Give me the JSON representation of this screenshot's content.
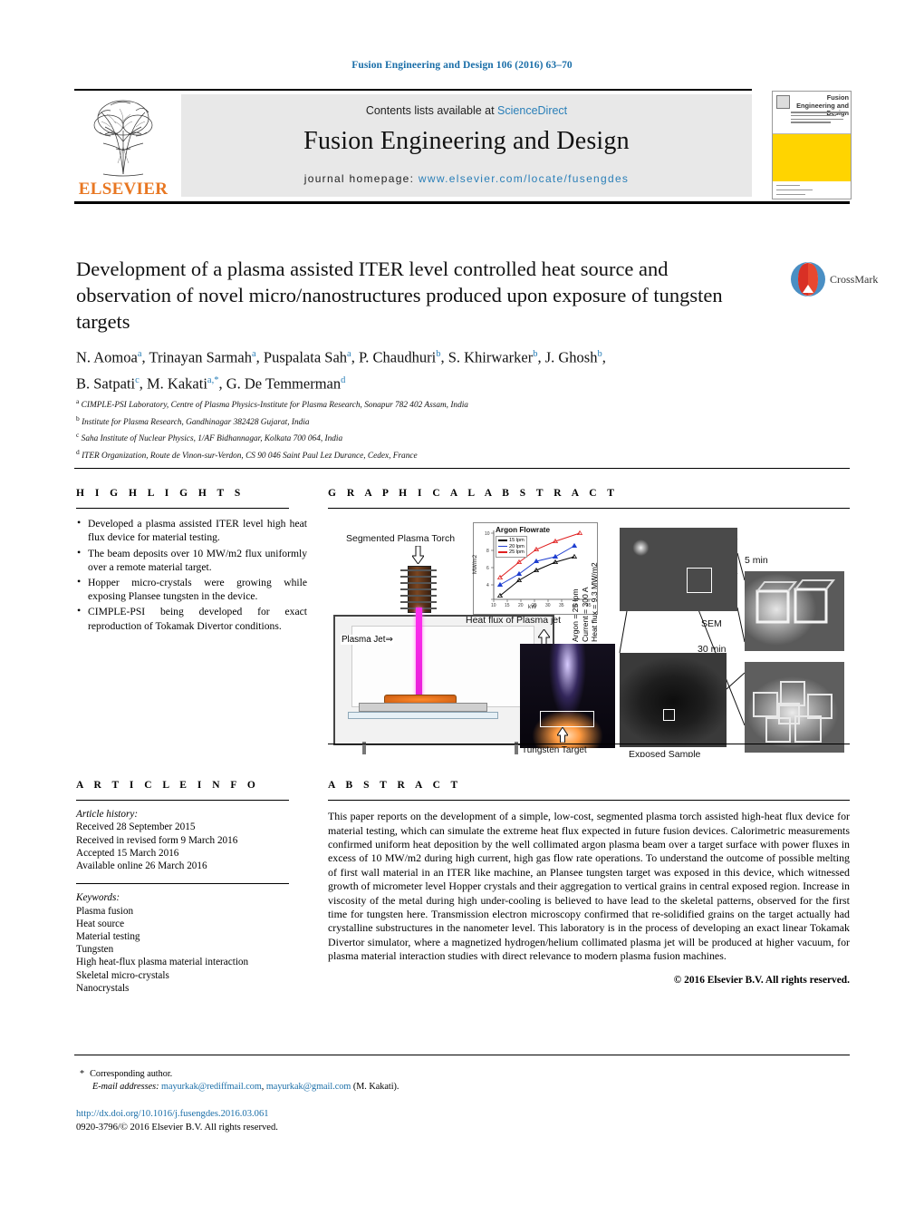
{
  "running_head": "Fusion Engineering and Design 106 (2016) 63–70",
  "masthead": {
    "contents_prefix": "Contents lists available at ",
    "sciencedirect": "ScienceDirect",
    "journal_title": "Fusion Engineering and Design",
    "homepage_prefix": "journal homepage: ",
    "homepage_url": "www.elsevier.com/locate/fusengdes",
    "publisher": "ELSEVIER",
    "cover_journal_title": "Fusion Engineering and Design",
    "cover_accent_color": "#FFD400"
  },
  "article": {
    "title": "Development of a plasma assisted ITER level controlled heat source and observation of novel micro/nanostructures produced upon exposure of tungsten targets",
    "crossmark_label": "CrossMark",
    "authors_line1": "N. Aomoa a, Trinayan Sarmah a, Puspalata Sah a, P. Chaudhuri b, S. Khirwarker b, J. Ghosh b,",
    "authors_line2": "B. Satpati c, M. Kakati a,*, G. De Temmerman d",
    "affiliations": [
      "CIMPLE-PSI Laboratory, Centre of Plasma Physics-Institute for Plasma Research, Sonapur 782 402 Assam, India",
      "Institute for Plasma Research, Gandhinagar 382428 Gujarat, India",
      "Saha Institute of Nuclear Physics, 1/AF Bidhannagar, Kolkata 700 064, India",
      "ITER Organization, Route de Vinon-sur-Verdon, CS 90 046 Saint Paul Lez Durance, Cedex, France"
    ],
    "affiliation_markers": [
      "a",
      "b",
      "c",
      "d"
    ]
  },
  "highlights": {
    "heading": "H I G H L I G H T S",
    "items": [
      "Developed a plasma assisted ITER level high heat flux device for material testing.",
      "The beam deposits over 10 MW/m2 flux uniformly over a remote material target.",
      "Hopper micro-crystals were growing while exposing Plansee tungsten in the device.",
      "CIMPLE-PSI being developed for exact reproduction of Tokamak Divertor conditions."
    ]
  },
  "graphical_abstract": {
    "heading": "G R A P H I C A L   A B S T R A C T",
    "labels": {
      "torch": "Segmented Plasma Torch",
      "plasma_jet": "Plasma Jet",
      "heat_flux_caption": "Heat flux of Plasma jet",
      "tungsten_target": "Tungsten Target",
      "sem": "SEM",
      "exposed_sample": "Exposed Sample",
      "five_min": "5 min",
      "thirty_min": "30 min",
      "param_argon": "Argon = 25 lpm",
      "param_current": "Current = 300 A",
      "param_heatflux": "Heat flux = 9.3 MW/m2"
    }
  },
  "chart_data": {
    "type": "line",
    "title": "Argon Flowrate",
    "xlabel": "kW",
    "ylabel": "MW/m2",
    "xlim": [
      10,
      45
    ],
    "ylim": [
      2,
      10
    ],
    "xticks": [
      10,
      15,
      20,
      25,
      30,
      35,
      40,
      45
    ],
    "yticks": [
      4,
      6,
      8,
      10
    ],
    "grid": false,
    "legend_position": "top-left",
    "series": [
      {
        "name": "15 lpm",
        "color": "#000000",
        "x": [
          12.5,
          19.5,
          26,
          33,
          40
        ],
        "values": [
          2.6,
          4.4,
          5.5,
          6.5,
          7.1
        ]
      },
      {
        "name": "20 lpm",
        "color": "#1f3fd0",
        "x": [
          12.5,
          19.5,
          26,
          33,
          40
        ],
        "values": [
          3.8,
          5.1,
          6.6,
          7.2,
          8.5
        ]
      },
      {
        "name": "25 lpm",
        "color": "#e02020",
        "x": [
          12.5,
          19.5,
          26,
          33,
          42
        ],
        "values": [
          4.6,
          6.4,
          7.9,
          8.9,
          10.0
        ]
      }
    ]
  },
  "article_info": {
    "heading": "A R T I C L E   I N F O",
    "history_label": "Article history:",
    "history": [
      "Received 28 September 2015",
      "Received in revised form 9 March 2016",
      "Accepted 15 March 2016",
      "Available online 26 March 2016"
    ],
    "keywords_label": "Keywords:",
    "keywords": [
      "Plasma fusion",
      "Heat source",
      "Material testing",
      "Tungsten",
      "High heat-flux plasma material interaction",
      "Skeletal micro-crystals",
      "Nanocrystals"
    ]
  },
  "abstract": {
    "heading": "A B S T R A C T",
    "text": "This paper reports on the development of a simple, low-cost, segmented plasma torch assisted high-heat flux device for material testing, which can simulate the extreme heat flux expected in future fusion devices. Calorimetric measurements confirmed uniform heat deposition by the well collimated argon plasma beam over a target surface with power fluxes in excess of 10 MW/m2 during high current, high gas flow rate operations. To understand the outcome of possible melting of first wall material in an ITER like machine, an Plansee tungsten target was exposed in this device, which witnessed growth of micrometer level Hopper crystals and their aggregation to vertical grains in central exposed region. Increase in viscosity of the metal during high under-cooling is believed to have lead to the skeletal patterns, observed for the first time for tungsten here. Transmission electron microscopy confirmed that re-solidified grains on the target actually had crystalline substructures in the nanometer level. This laboratory is in the process of developing an exact linear Tokamak Divertor simulator, where a magnetized hydrogen/helium collimated plasma jet will be produced at higher vacuum, for plasma material interaction studies with direct relevance to modern plasma fusion machines.",
    "copyright": "© 2016 Elsevier B.V. All rights reserved."
  },
  "footer": {
    "corresponding_marker": "*",
    "corresponding_label": "Corresponding author.",
    "email_label": "E-mail addresses:",
    "email1": "mayurkak@rediffmail.com",
    "email_sep": ", ",
    "email2": "mayurkak@gmail.com",
    "email_suffix": " (M. Kakati).",
    "doi_url": "http://dx.doi.org/10.1016/j.fusengdes.2016.03.061",
    "issn_line": "0920-3796/© 2016 Elsevier B.V. All rights reserved."
  }
}
